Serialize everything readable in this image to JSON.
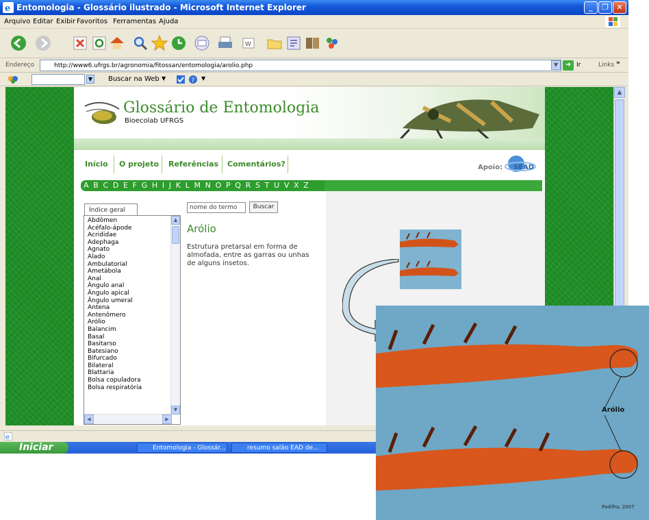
{
  "window": {
    "title": "Entomologia - Glossário ilustrado - Microsoft Internet Explorer"
  },
  "menu": [
    "Arquivo",
    "Editar",
    "Exibir",
    "Favoritos",
    "Ferramentas",
    "Ajuda"
  ],
  "address": {
    "label": "Endereço",
    "url": "http://www6.ufrgs.br/agronomia/fitossan/entomologia/arolio.php",
    "go_label": "Ir",
    "links_label": "Links"
  },
  "search_toolbar": {
    "button_label": "Buscar na Web"
  },
  "site": {
    "title": "Glossário de Entomologia",
    "subtitle": "Bioecolab UFRGS",
    "nav": [
      "Início",
      "O projeto",
      "Referências",
      "Comentários?"
    ],
    "apoio_label": "Apoio:",
    "sead_label": "SEAD",
    "alphabet": "A B C D E F G H I J K L M N O P Q R S T U V X Z"
  },
  "index": {
    "tab_label": "Índice geral",
    "items": [
      "Abdômen",
      "Acéfalo-ápode",
      "Acrididae",
      "Adephaga",
      "Agnato",
      "Alado",
      "Ambulatorial",
      "Ametábola",
      "Anal",
      "Ângulo anal",
      "Ângulo apical",
      "Ângulo umeral",
      "Antena",
      "Antenômero",
      "Arólio",
      "Balancim",
      "Basal",
      "Basitarso",
      "Batesiano",
      "Bifurcado",
      "Bilateral",
      "Blattaria",
      "Bolsa copuladora",
      "Bolsa respiratória"
    ]
  },
  "search": {
    "placeholder": "nome do termo",
    "button_label": "Buscar"
  },
  "term": {
    "title": "Arólio",
    "description": "Estrutura pretarsal em forma de almofada, entre as garras ou unhas de alguns insetos."
  },
  "taskbar": {
    "start_label": "Iniciar",
    "tasks": [
      "Entomologia - Glossár...",
      "resumo salão EAD de..."
    ]
  },
  "zoom_image": {
    "label": "Arólio",
    "credit": "Padilha, 2007"
  }
}
